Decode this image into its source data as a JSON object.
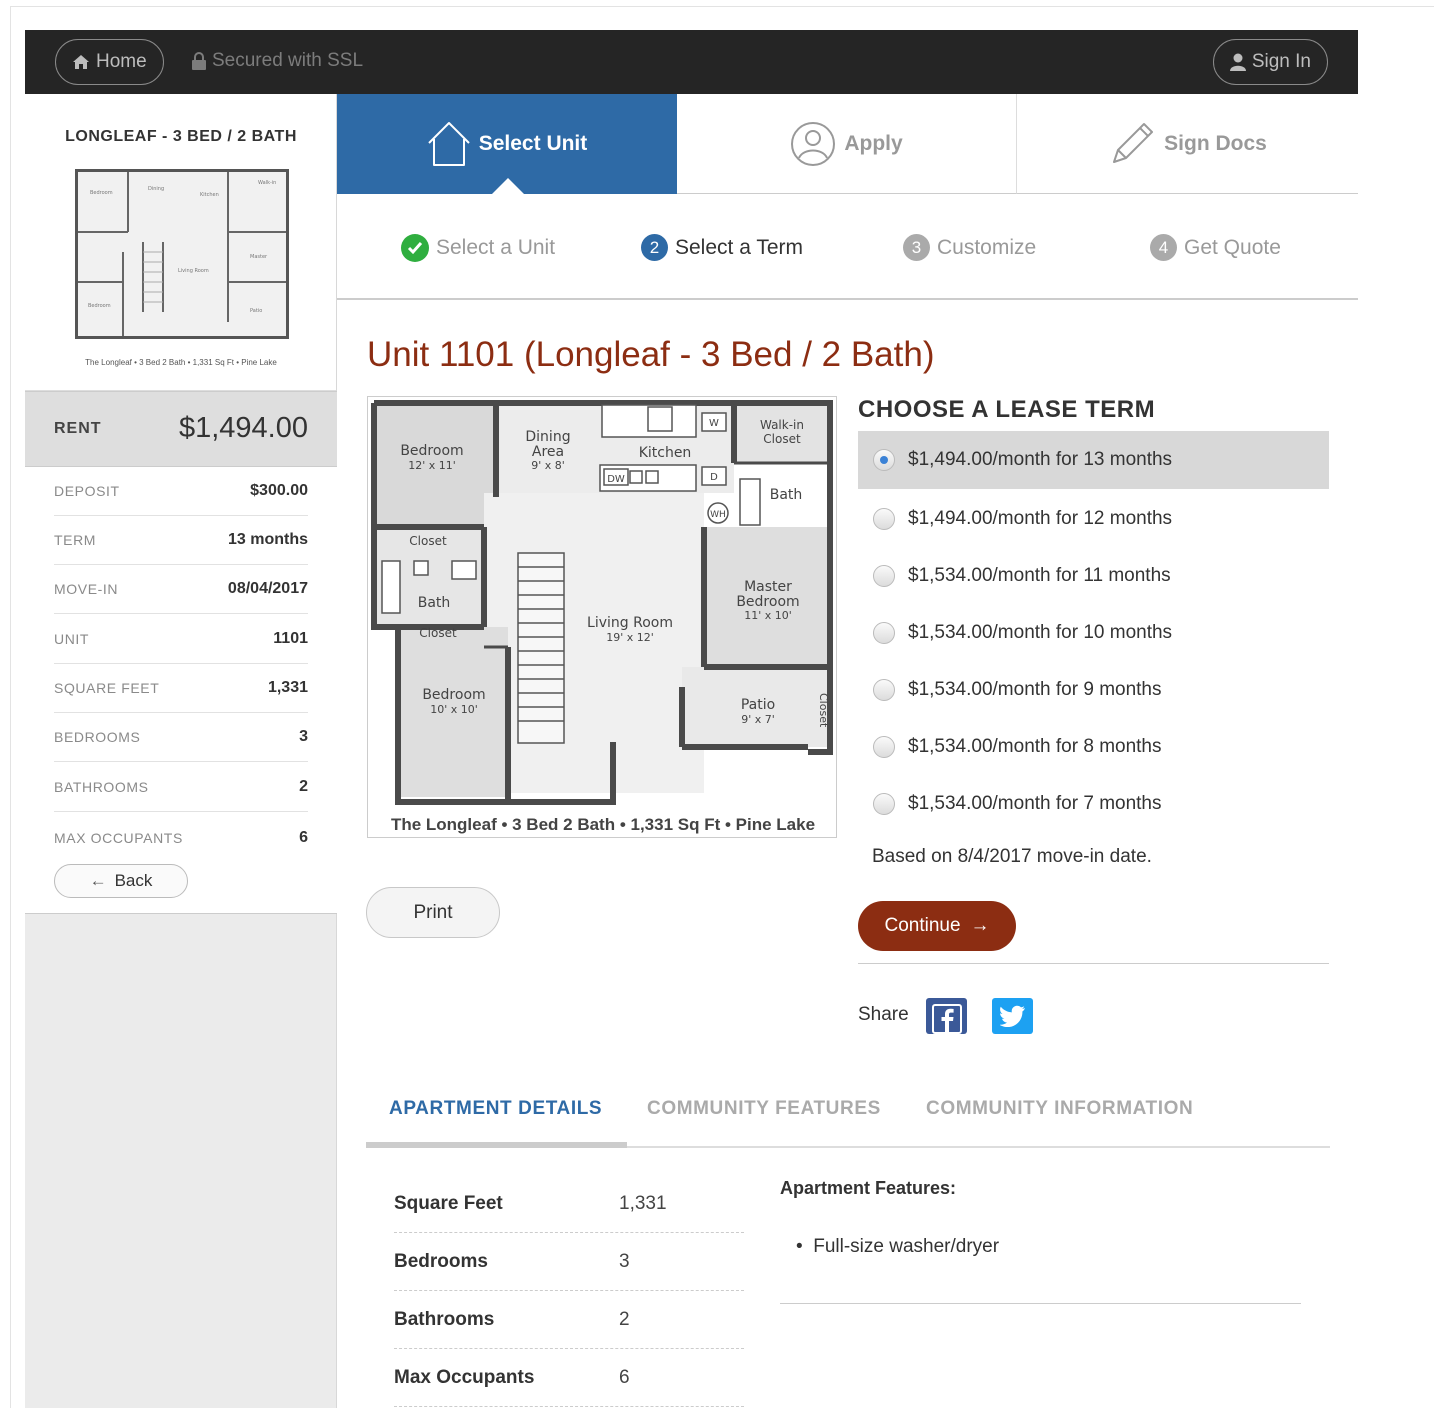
{
  "topbar": {
    "home_label": "Home",
    "ssl_label": "Secured with SSL",
    "signin_label": "Sign In"
  },
  "sidebar": {
    "unit_name": "LONGLEAF - 3 BED / 2 BATH",
    "thumb_caption": "The Longleaf • 3 Bed 2 Bath • 1,331 Sq Ft • Pine Lake",
    "rent_label": "RENT",
    "rent_value": "$1,494.00",
    "rows": [
      {
        "label": "DEPOSIT",
        "value": "$300.00"
      },
      {
        "label": "TERM",
        "value": "13 months"
      },
      {
        "label": "MOVE-IN",
        "value": "08/04/2017"
      },
      {
        "label": "UNIT",
        "value": "1101"
      },
      {
        "label": "SQUARE FEET",
        "value": "1,331"
      },
      {
        "label": "BEDROOMS",
        "value": "3"
      },
      {
        "label": "BATHROOMS",
        "value": "2"
      },
      {
        "label": "MAX OCCUPANTS",
        "value": "6"
      }
    ],
    "back_label": "Back"
  },
  "main_steps": [
    {
      "label": "Select Unit",
      "active": true
    },
    {
      "label": "Apply",
      "active": false
    },
    {
      "label": "Sign Docs",
      "active": false
    }
  ],
  "sub_steps": [
    {
      "num": "",
      "label": "Select a Unit",
      "state": "done"
    },
    {
      "num": "2",
      "label": "Select a Term",
      "state": "current"
    },
    {
      "num": "3",
      "label": "Customize",
      "state": "todo"
    },
    {
      "num": "4",
      "label": "Get Quote",
      "state": "todo"
    }
  ],
  "unit_title": "Unit 1101 (Longleaf - 3 Bed / 2 Bath)",
  "floorplan": {
    "caption": "The Longleaf • 3 Bed 2 Bath • 1,331 Sq Ft • Pine Lake",
    "rooms": {
      "bedroom1": "Bedroom",
      "bedroom1_size": "12' x 11'",
      "dining": "Dining",
      "dining2": "Area",
      "dining_size": "9' x 8'",
      "kitchen": "Kitchen",
      "walkin": "Walk-in",
      "walkin2": "Closet",
      "bath1": "Bath",
      "closet1": "Closet",
      "bath2": "Bath",
      "closet2": "Closet",
      "living": "Living Room",
      "living_size": "19' x 12'",
      "master": "Master",
      "master2": "Bedroom",
      "master_size": "11' x 10'",
      "bedroom2": "Bedroom",
      "bedroom2_size": "10' x 10'",
      "patio": "Patio",
      "patio_size": "9' x 7'",
      "closet3": "Closet",
      "dw": "DW",
      "w": "W",
      "d": "D",
      "wh": "WH"
    }
  },
  "print_label": "Print",
  "lease": {
    "title": "CHOOSE A LEASE TERM",
    "options": [
      {
        "label": "$1,494.00/month for 13 months",
        "selected": true
      },
      {
        "label": "$1,494.00/month for 12 months",
        "selected": false
      },
      {
        "label": "$1,534.00/month for 11 months",
        "selected": false
      },
      {
        "label": "$1,534.00/month for 10 months",
        "selected": false
      },
      {
        "label": "$1,534.00/month for 9 months",
        "selected": false
      },
      {
        "label": "$1,534.00/month for 8 months",
        "selected": false
      },
      {
        "label": "$1,534.00/month for 7 months",
        "selected": false
      }
    ],
    "based_on": "Based on 8/4/2017 move-in date.",
    "continue_label": "Continue"
  },
  "share_label": "Share",
  "tabs": [
    {
      "label": "APARTMENT DETAILS",
      "active": true
    },
    {
      "label": "COMMUNITY FEATURES",
      "active": false
    },
    {
      "label": "COMMUNITY INFORMATION",
      "active": false
    }
  ],
  "details": [
    {
      "label": "Square Feet",
      "value": "1,331"
    },
    {
      "label": "Bedrooms",
      "value": "3"
    },
    {
      "label": "Bathrooms",
      "value": "2"
    },
    {
      "label": "Max Occupants",
      "value": "6"
    }
  ],
  "features": {
    "title": "Apartment Features:",
    "items": [
      "Full-size washer/dryer"
    ]
  },
  "colors": {
    "brand_blue": "#2e6aa6",
    "accent_red": "#8c2d12",
    "topbar": "#252525",
    "done_green": "#2fae3f"
  }
}
